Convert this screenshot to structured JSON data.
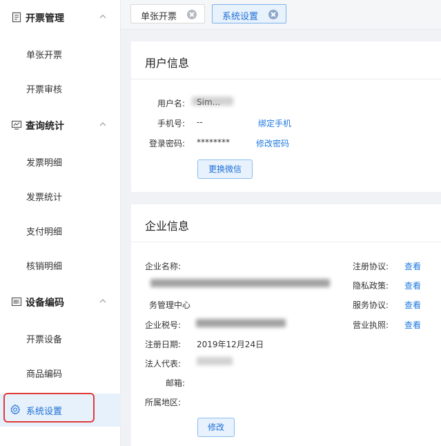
{
  "sidebar": {
    "groups": [
      {
        "title": "开票管理",
        "icon": "document-list-icon",
        "items": [
          "单张开票",
          "开票审核"
        ]
      },
      {
        "title": "查询统计",
        "icon": "monitor-chart-icon",
        "items": [
          "发票明细",
          "发票统计",
          "支付明细",
          "核销明细"
        ]
      },
      {
        "title": "设备编码",
        "icon": "barcode-icon",
        "items": [
          "开票设备",
          "商品编码"
        ]
      }
    ],
    "active_item": {
      "label": "系统设置",
      "icon": "gear-icon"
    }
  },
  "tabs": [
    {
      "label": "单张开票",
      "active": false
    },
    {
      "label": "系统设置",
      "active": true
    }
  ],
  "user_info": {
    "title": "用户信息",
    "username_label": "用户名:",
    "username_value": "Sim...",
    "phone_label": "手机号:",
    "phone_value": "--",
    "bind_phone_link": "绑定手机",
    "password_label": "登录密码:",
    "password_value": "********",
    "change_password_link": "修改密码",
    "change_wechat_button": "更换微信"
  },
  "company_info": {
    "title": "企业信息",
    "name_label": "企业名称:",
    "name_value_line2": "务管理中心",
    "tax_id_label": "企业税号:",
    "reg_date_label": "注册日期:",
    "reg_date_value": "2019年12月24日",
    "legal_rep_label": "法人代表:",
    "email_label": "邮箱:",
    "region_label": "所属地区:",
    "edit_button": "修改",
    "docs": [
      {
        "label": "注册协议:",
        "link": "查看"
      },
      {
        "label": "隐私政策:",
        "link": "查看"
      },
      {
        "label": "服务协议:",
        "link": "查看"
      },
      {
        "label": "营业执照:",
        "link": "查看"
      }
    ]
  },
  "colors": {
    "accent": "#1f7ae0",
    "active_bg": "#e6f1fc",
    "highlight_border": "#e23a36"
  }
}
